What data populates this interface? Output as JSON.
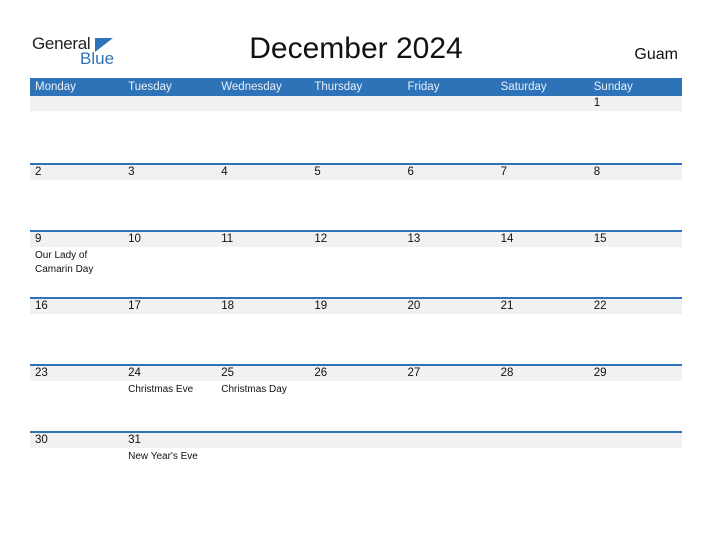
{
  "logo": {
    "word1": "General",
    "word2": "Blue"
  },
  "title": "December 2024",
  "region": "Guam",
  "colors": {
    "accent": "#2e73b8",
    "strip": "#f1f1f1"
  },
  "weekdays": [
    "Monday",
    "Tuesday",
    "Wednesday",
    "Thursday",
    "Friday",
    "Saturday",
    "Sunday"
  ],
  "weeks": [
    [
      {
        "d": ""
      },
      {
        "d": ""
      },
      {
        "d": ""
      },
      {
        "d": ""
      },
      {
        "d": ""
      },
      {
        "d": ""
      },
      {
        "d": "1"
      }
    ],
    [
      {
        "d": "2"
      },
      {
        "d": "3"
      },
      {
        "d": "4"
      },
      {
        "d": "5"
      },
      {
        "d": "6"
      },
      {
        "d": "7"
      },
      {
        "d": "8"
      }
    ],
    [
      {
        "d": "9",
        "e": "Our Lady of Camarin Day"
      },
      {
        "d": "10"
      },
      {
        "d": "11"
      },
      {
        "d": "12"
      },
      {
        "d": "13"
      },
      {
        "d": "14"
      },
      {
        "d": "15"
      }
    ],
    [
      {
        "d": "16"
      },
      {
        "d": "17"
      },
      {
        "d": "18"
      },
      {
        "d": "19"
      },
      {
        "d": "20"
      },
      {
        "d": "21"
      },
      {
        "d": "22"
      }
    ],
    [
      {
        "d": "23"
      },
      {
        "d": "24",
        "e": "Christmas Eve"
      },
      {
        "d": "25",
        "e": "Christmas Day"
      },
      {
        "d": "26"
      },
      {
        "d": "27"
      },
      {
        "d": "28"
      },
      {
        "d": "29"
      }
    ],
    [
      {
        "d": "30"
      },
      {
        "d": "31",
        "e": "New Year's Eve"
      },
      {
        "d": ""
      },
      {
        "d": ""
      },
      {
        "d": ""
      },
      {
        "d": ""
      },
      {
        "d": ""
      }
    ]
  ]
}
